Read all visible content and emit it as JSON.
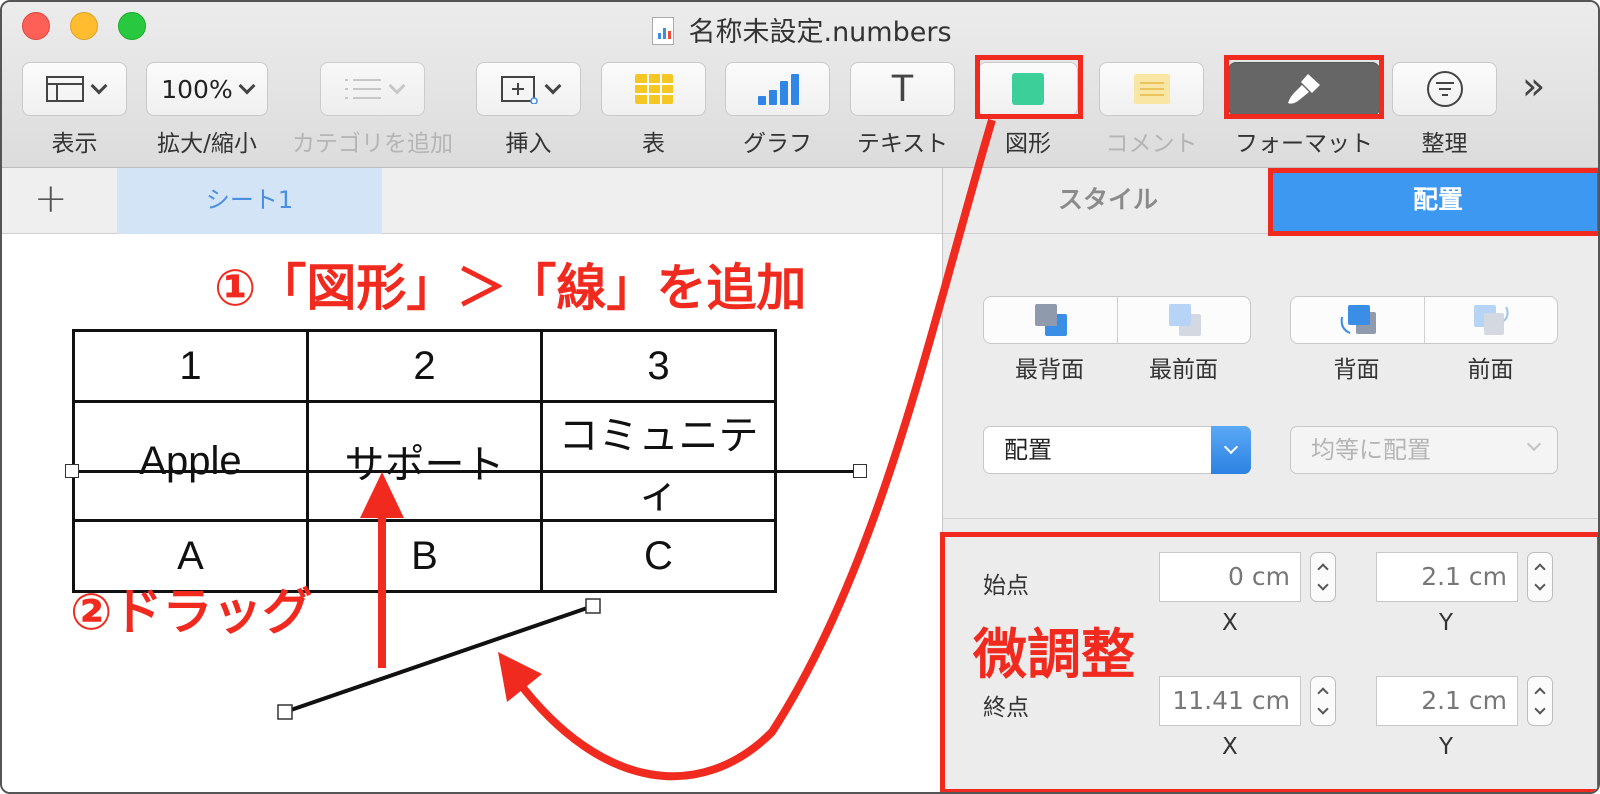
{
  "window": {
    "title": "名称未設定.numbers"
  },
  "toolbar": {
    "view": {
      "label": "表示"
    },
    "zoom": {
      "value": "100%",
      "label": "拡大/縮小"
    },
    "category": {
      "label": "カテゴリを追加"
    },
    "insert": {
      "label": "挿入"
    },
    "table": {
      "label": "表"
    },
    "chart": {
      "label": "グラフ"
    },
    "text": {
      "label": "テキスト",
      "glyph": "T"
    },
    "shape": {
      "label": "図形"
    },
    "comment": {
      "label": "コメント"
    },
    "format": {
      "label": "フォーマット"
    },
    "organize": {
      "label": "整理"
    },
    "more": {
      "glyph": "»"
    }
  },
  "tabs": {
    "add": "+",
    "sheet": "シート1"
  },
  "sidebar": {
    "tabs": {
      "style": "スタイル",
      "arrange": "配置"
    },
    "order": {
      "back": "最背面",
      "front": "最前面",
      "backward": "背面",
      "forward": "前面"
    },
    "align": {
      "value": "配置"
    },
    "distribute": {
      "value": "均等に配置"
    },
    "start": {
      "label": "始点",
      "x": "0 cm",
      "y": "2.1 cm"
    },
    "end": {
      "label": "終点",
      "x": "11.41 cm",
      "y": "2.1 cm"
    },
    "x_label": "X",
    "y_label": "Y"
  },
  "table": {
    "rows": [
      [
        "1",
        "2",
        "3"
      ],
      [
        "Apple",
        "サポート",
        "コミュニティ"
      ],
      [
        "A",
        "B",
        "C"
      ]
    ]
  },
  "annotations": {
    "step1": "①「図形」＞「線」を追加",
    "step2": "②ドラッグ",
    "fine_tune": "微調整"
  },
  "colors": {
    "annotation_red": "#f02a1e",
    "accent_blue": "#3d98f2",
    "shape_green": "#3ccf9a",
    "table_yellow": "#f6c624"
  }
}
